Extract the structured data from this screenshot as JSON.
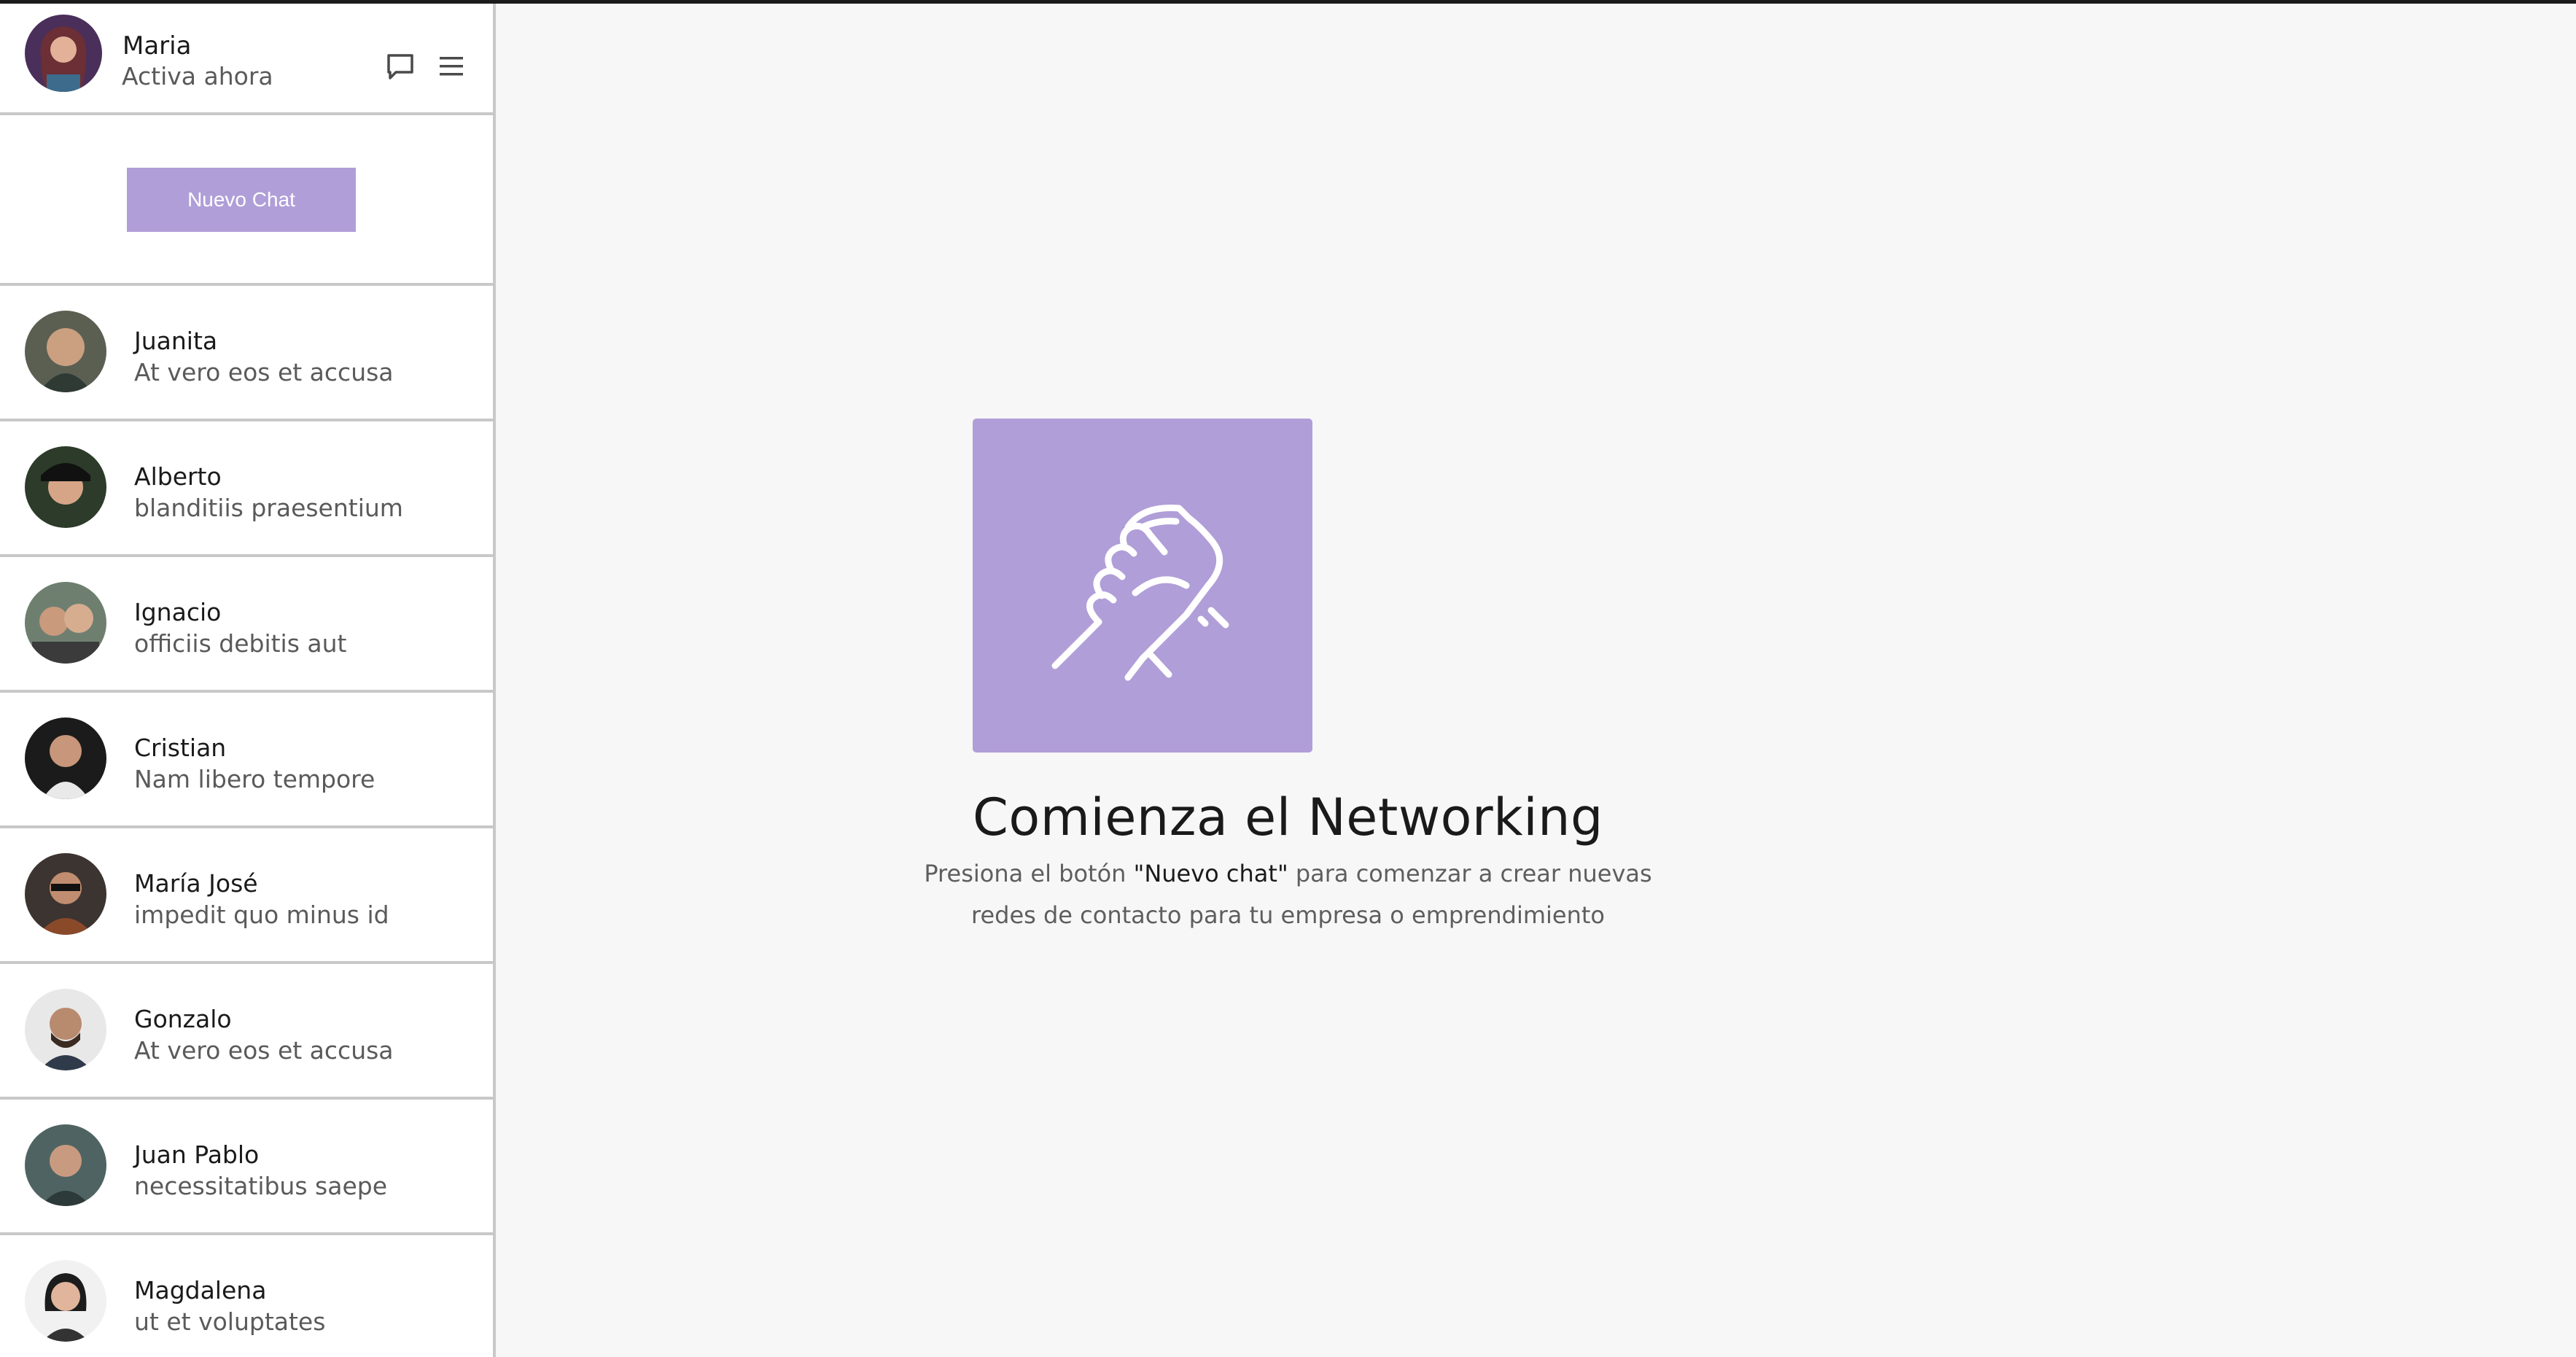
{
  "user": {
    "name": "Maria",
    "status": "Activa ahora"
  },
  "toolbar": {
    "chat_icon": "chat-bubble-icon",
    "menu_icon": "hamburger-menu-icon"
  },
  "new_chat_button": "Nuevo Chat",
  "contacts": [
    {
      "name": "Juanita",
      "message": "At vero eos et accusa"
    },
    {
      "name": "Alberto",
      "message": "blanditiis praesentium"
    },
    {
      "name": "Ignacio",
      "message": "officiis debitis aut"
    },
    {
      "name": "Cristian",
      "message": "Nam libero tempore"
    },
    {
      "name": "María José",
      "message": "impedit quo minus id"
    },
    {
      "name": "Gonzalo",
      "message": "At vero eos et accusa"
    },
    {
      "name": "Juan Pablo",
      "message": "necessitatibus saepe"
    },
    {
      "name": "Magdalena",
      "message": "ut et voluptates"
    }
  ],
  "empty_state": {
    "icon": "handshake-icon",
    "title": "Comienza el Networking",
    "text_before": "Presiona el botón ",
    "text_highlight": "\"Nuevo chat\"",
    "text_after": " para comenzar a crear nuevas",
    "text_line2": "redes de contacto para tu empresa o emprendimiento"
  },
  "colors": {
    "accent": "#b09ed8",
    "sidebar_bg": "#ffffff",
    "main_bg": "#f7f7f7",
    "divider": "#c8c8c8"
  }
}
